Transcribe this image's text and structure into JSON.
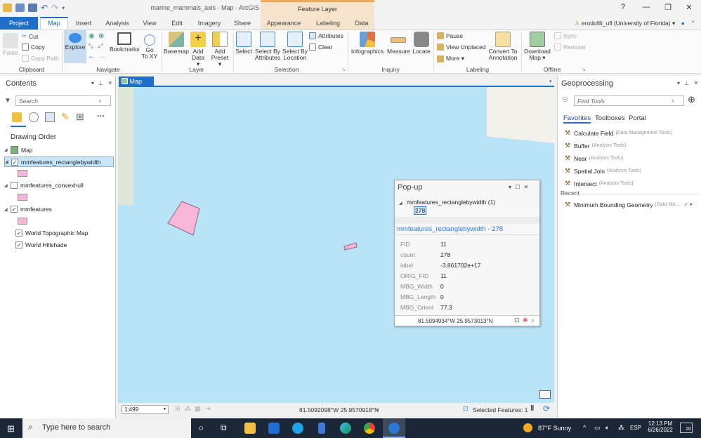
{
  "titlebar": {
    "title": "marine_mammals_axis - Map - ArcGIS Pro",
    "context_header": "Feature Layer",
    "help": "?",
    "minimize": "—",
    "restore": "❐",
    "close": "✕"
  },
  "tabs": {
    "project": "Project",
    "map": "Map",
    "insert": "Insert",
    "analysis": "Analysis",
    "view": "View",
    "edit": "Edit",
    "imagery": "Imagery",
    "share": "Share",
    "appearance": "Appearance",
    "labeling": "Labeling",
    "data": "Data"
  },
  "user": {
    "name": "erodofili_ufl (University of Florida)",
    "dropdown": "▾"
  },
  "ribbon": {
    "clipboard": {
      "group": "Clipboard",
      "paste": "Paste",
      "cut": "Cut",
      "copy": "Copy",
      "copy_path": "Copy Path"
    },
    "navigate": {
      "group": "Navigate",
      "explore": "Explore",
      "bookmarks": "Bookmarks",
      "goto_1": "Go",
      "goto_2": "To XY"
    },
    "layer": {
      "group": "Layer",
      "basemap": "Basemap",
      "add_data_1": "Add",
      "add_data_2": "Data ▾",
      "add_preset_1": "Add",
      "add_preset_2": "Preset ▾"
    },
    "selection": {
      "group": "Selection",
      "select": "Select",
      "select_by_attr_1": "Select By",
      "select_by_attr_2": "Attributes",
      "select_by_loc_1": "Select By",
      "select_by_loc_2": "Location",
      "attributes": "Attributes",
      "clear": "Clear"
    },
    "inquiry": {
      "group": "Inquiry",
      "infographics": "Infographics",
      "measure": "Measure",
      "locate": "Locate"
    },
    "labeling": {
      "group": "Labeling",
      "pause": "Pause",
      "view_unplaced": "View Unplaced",
      "more": "More ▾",
      "convert_1": "Convert To",
      "convert_2": "Annotation"
    },
    "offline": {
      "group": "Offline",
      "download_1": "Download",
      "download_2": "Map ▾",
      "sync": "Sync",
      "remove": "Remove"
    }
  },
  "contents": {
    "title": "Contents",
    "search_placeholder": "Search",
    "drawing_order": "Drawing Order",
    "map_label": "Map",
    "layers": [
      {
        "name": "mmfeatures_rectanglebywidth",
        "checked": true,
        "selected": true
      },
      {
        "name": "mmfeatures_convexhull",
        "checked": false
      },
      {
        "name": "mmfeatures",
        "checked": true
      },
      {
        "name": "World Topographic Map",
        "checked": true
      },
      {
        "name": "World Hillshade",
        "checked": true
      }
    ],
    "swatch_color": "#f7b6d8"
  },
  "map": {
    "tab_label": "Map",
    "water_color": "#b9e4f8",
    "feature_color": "#f7b6d8"
  },
  "popup": {
    "title": "Pop-up",
    "layer_entry": "mmfeatures_rectanglebywidth  (1)",
    "feature_id": "278",
    "header_link": "mmfeatures_rectanglebywidth - 278",
    "fields": [
      {
        "key": "FID",
        "value": "11"
      },
      {
        "key": "count",
        "value": "278"
      },
      {
        "key": "label",
        "value": "-3.861702e+17"
      },
      {
        "key": "ORIG_FID",
        "value": "11"
      },
      {
        "key": "MBG_Width",
        "value": "0"
      },
      {
        "key": "MBG_Length",
        "value": "0"
      },
      {
        "key": "MBG_Orient",
        "value": "77.3"
      }
    ],
    "coordinates": "81.5094934°W 25.9573013°N"
  },
  "statusbar": {
    "scale": "1:499",
    "coordinates": "81.5092098°W 25.9570918°N",
    "selected_features": "Selected Features: 1"
  },
  "geoprocessing": {
    "title": "Geoprocessing",
    "search_placeholder": "Find Tools",
    "tabs": [
      "Favorites",
      "Toolboxes",
      "Portal"
    ],
    "favorites": [
      {
        "name": "Calculate Field",
        "toolbox": "(Data Management Tools)"
      },
      {
        "name": "Buffer",
        "toolbox": "(Analysis Tools)"
      },
      {
        "name": "Near",
        "toolbox": "(Analysis Tools)"
      },
      {
        "name": "Spatial Join",
        "toolbox": "(Analysis Tools)"
      },
      {
        "name": "Intersect",
        "toolbox": "(Analysis Tools)"
      }
    ],
    "recent_label": "Recent",
    "recent": [
      {
        "name": "Minimum Bounding Geometry",
        "toolbox": "(Data Ma...",
        "status": "✓"
      }
    ]
  },
  "taskbar": {
    "search_placeholder": "Type here to search",
    "weather": "87°F  Sunny",
    "language": "ESP",
    "time": "12:13 PM",
    "date": "6/26/2022",
    "notifications": "20"
  }
}
